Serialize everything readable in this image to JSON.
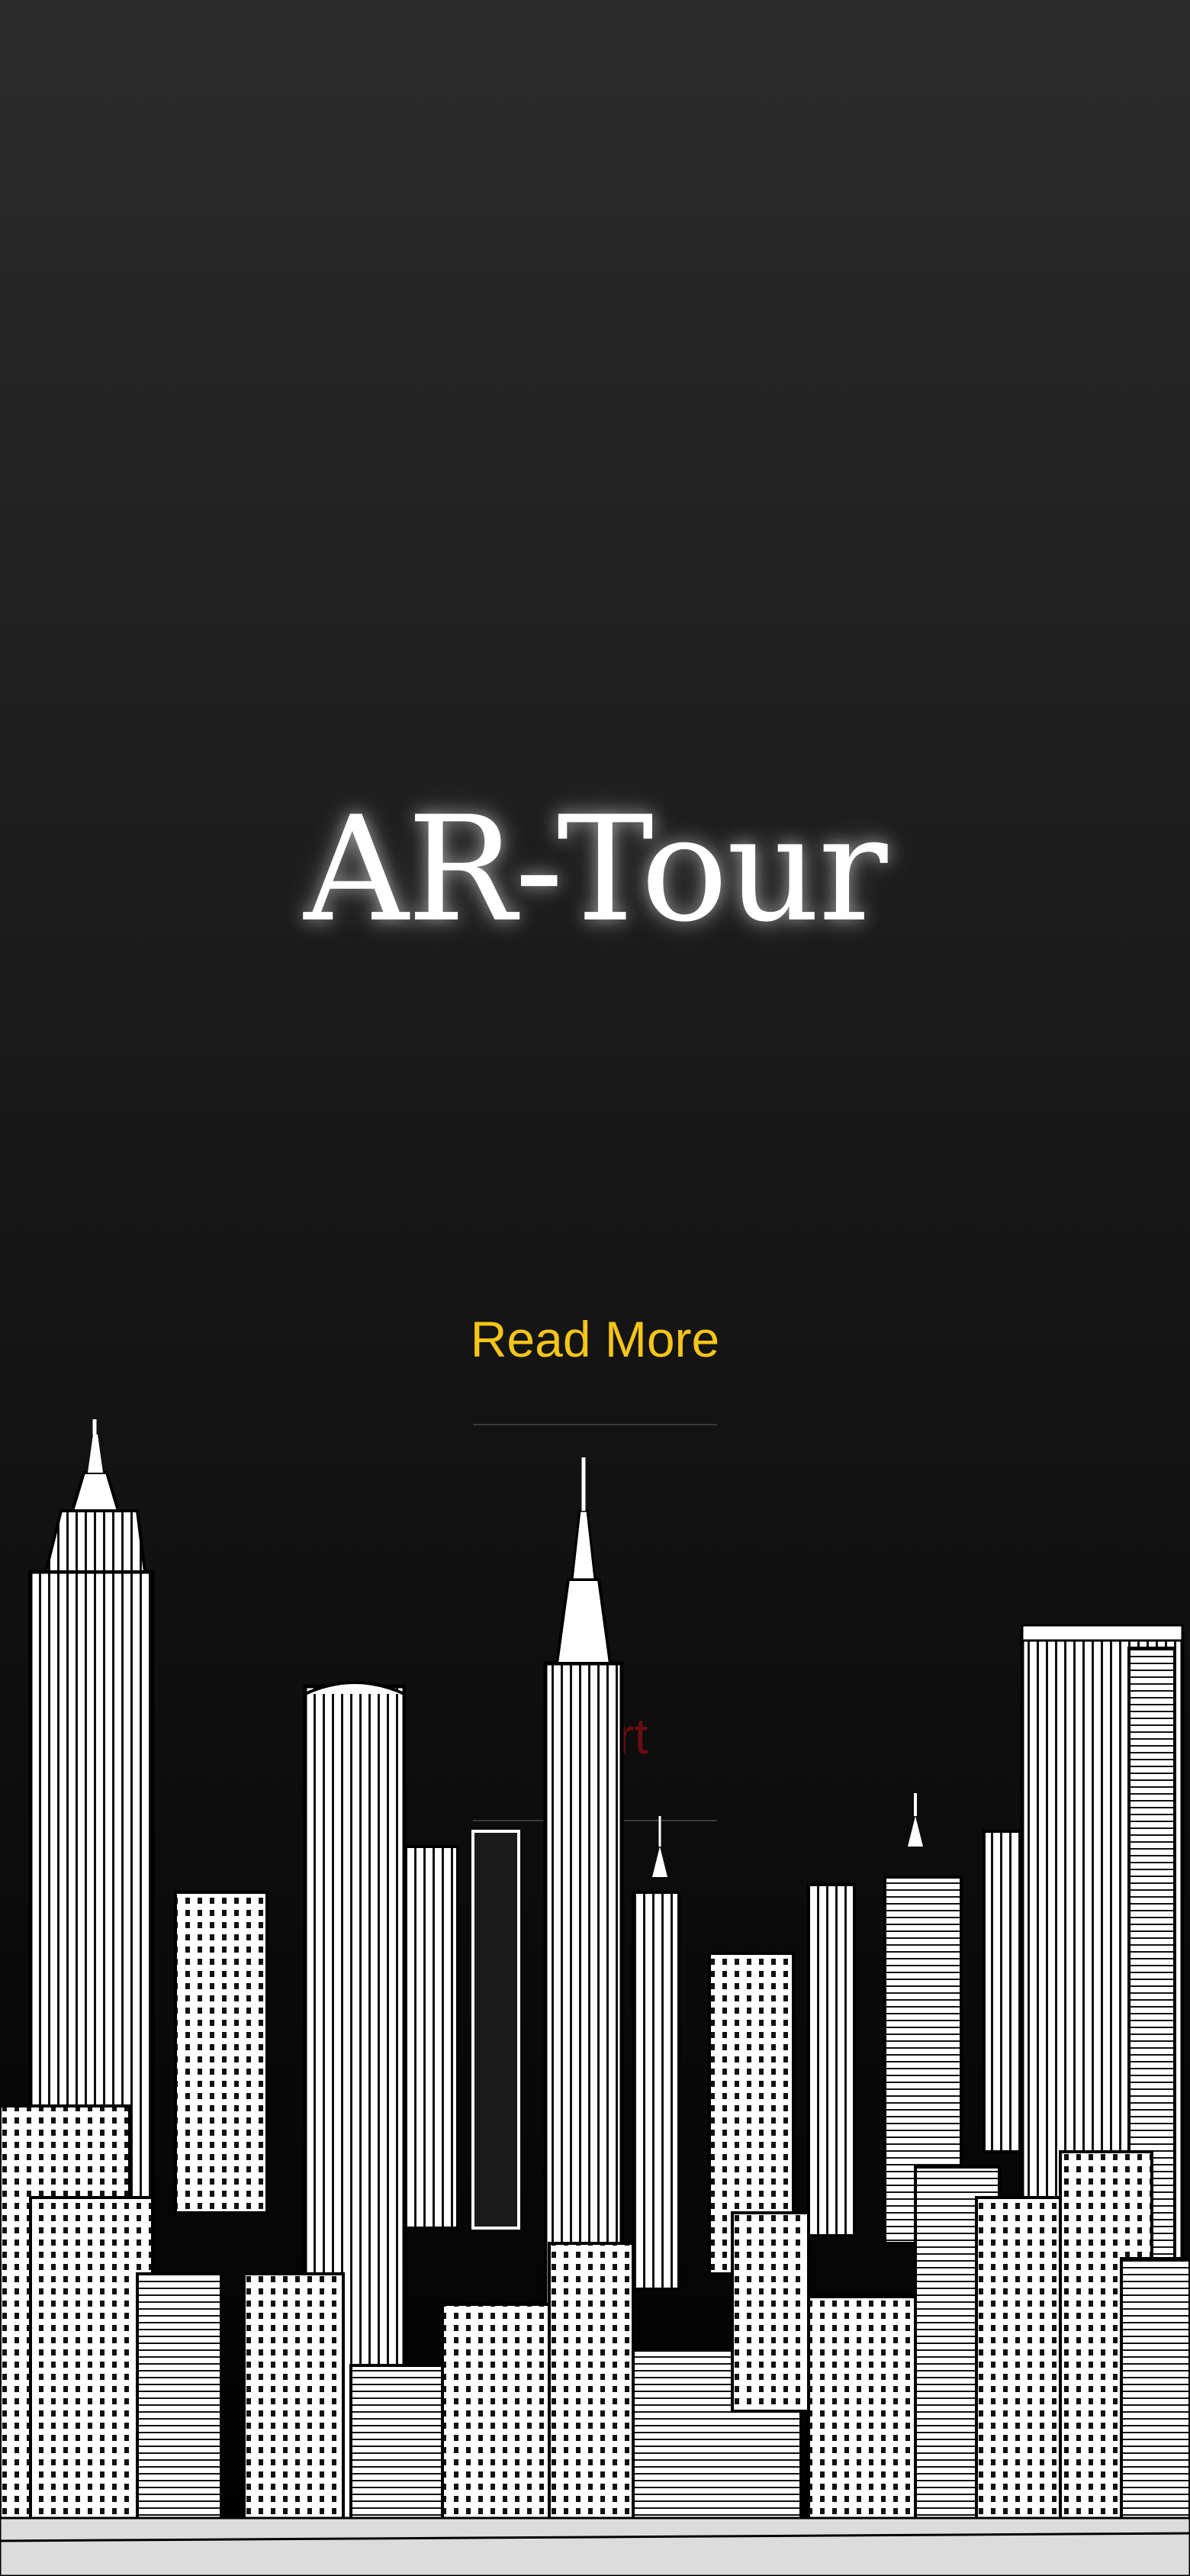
{
  "app": {
    "title": "AR-Tour"
  },
  "actions": {
    "read_more_label": "Read More",
    "start_label": "Start"
  },
  "theme": {
    "accent": "#f5c518",
    "start_color": "#6a0d12",
    "background": "#1a1a1a",
    "title_color": "#ffffff"
  },
  "illustration": {
    "name": "city-skyline-illustration"
  }
}
